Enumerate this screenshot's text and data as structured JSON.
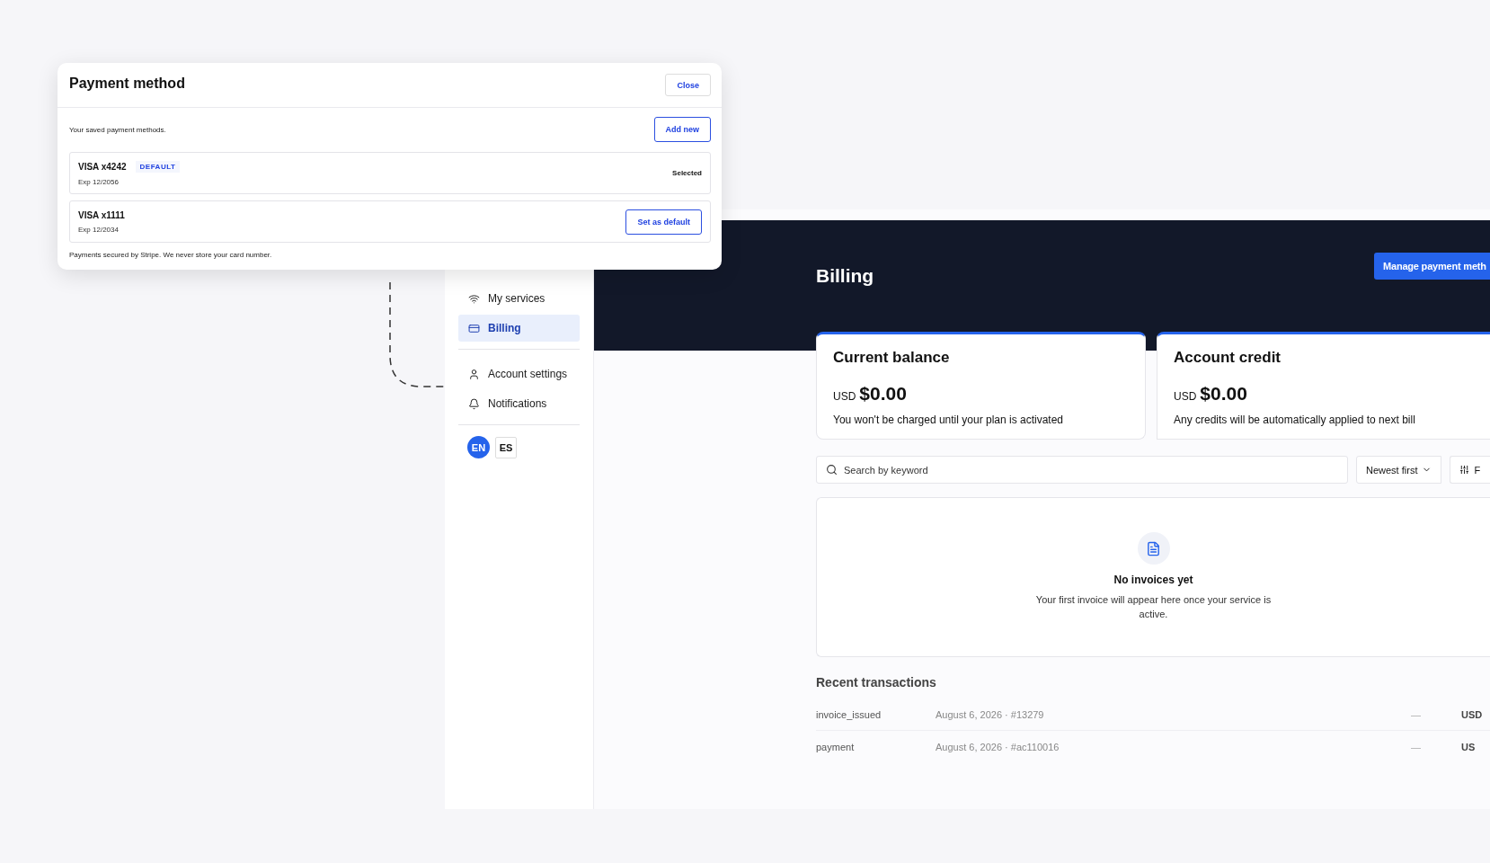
{
  "modal": {
    "title": "Payment method",
    "close": "Close",
    "subtitle": "Your saved payment methods.",
    "add": "Add new",
    "methods": [
      {
        "name": "VISA x4242",
        "badge": "DEFAULT",
        "expiry": "Exp 12/2056",
        "default": true,
        "status": "Selected"
      },
      {
        "name": "VISA x1111",
        "expiry": "Exp 12/2034",
        "default": false,
        "action": "Set as default"
      }
    ],
    "footer": "Payments secured by Stripe. We never store your card number."
  },
  "sidebar": {
    "groups": [
      [
        {
          "label": "My services",
          "selected": false
        },
        {
          "label": "Billing",
          "selected": true
        }
      ],
      [
        {
          "label": "Account settings",
          "selected": false
        },
        {
          "label": "Notifications",
          "selected": false
        }
      ]
    ],
    "languages": [
      {
        "label": "EN",
        "selected": true
      },
      {
        "label": "ES",
        "selected": false
      }
    ]
  },
  "header": {
    "title": "Billing",
    "action": "Manage payment meth"
  },
  "cards": [
    {
      "title": "Current balance",
      "currency": "USD",
      "amount": "$0.00",
      "note": "You won't be charged until your plan is activated"
    },
    {
      "title": "Account credit",
      "currency": "USD",
      "amount": "$0.00",
      "note": "Any credits will be automatically applied to next bill"
    }
  ],
  "search": {
    "placeholder": "Search by keyword"
  },
  "sort": {
    "label": "Newest first"
  },
  "filter": {
    "label": "F"
  },
  "empty_state": {
    "title": "No invoices yet",
    "message": "Your first invoice will appear here once your service is active."
  },
  "transactions": {
    "title": "Recent transactions",
    "rows": [
      {
        "type": "invoice_issued",
        "detail": "August 6, 2026 · #13279",
        "amount": "—",
        "currency": "USD"
      },
      {
        "type": "payment",
        "detail": "August 6, 2026 · #ac110016",
        "amount": "—",
        "currency": "US"
      }
    ]
  }
}
